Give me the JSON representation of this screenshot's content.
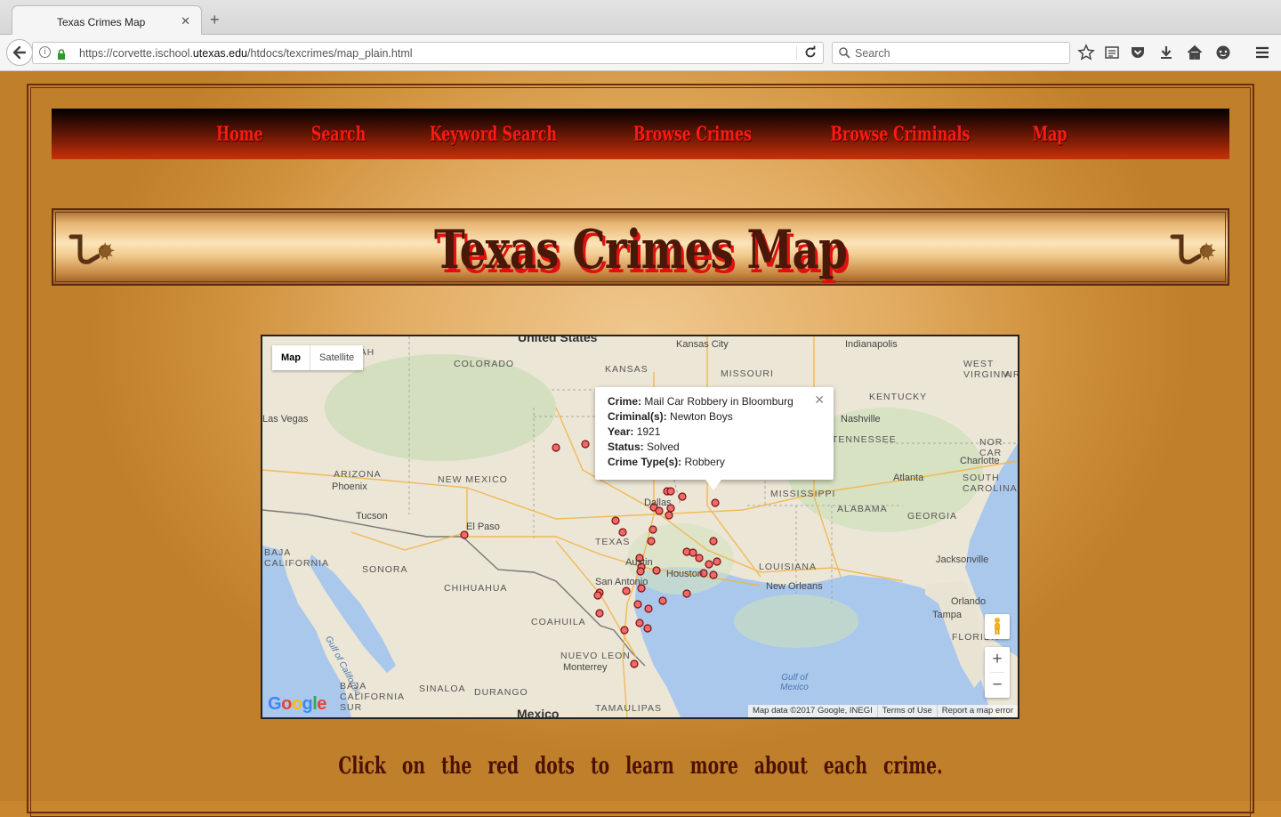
{
  "browser": {
    "tab_title": "Texas Crimes Map",
    "url_prefix": "https://corvette.ischool.",
    "url_domain": "utexas.edu",
    "url_suffix": "/htdocs/texcrimes/map_plain.html",
    "search_placeholder": "Search"
  },
  "nav": {
    "items": [
      "Home",
      "Search",
      "Keyword Search",
      "Browse Crimes",
      "Browse Criminals",
      "Map"
    ]
  },
  "banner": {
    "title": "Texas Crimes Map"
  },
  "map": {
    "type_buttons": [
      "Map",
      "Satellite"
    ],
    "selected_type": "Map",
    "infowindow": {
      "crime_label": "Crime:",
      "crime_value": "Mail Car Robbery in Bloomburg",
      "criminals_label": "Criminal(s):",
      "criminals_value": "Newton Boys",
      "year_label": "Year:",
      "year_value": "1921",
      "status_label": "Status:",
      "status_value": "Solved",
      "type_label": "Crime Type(s):",
      "type_value": "Robbery"
    },
    "zoom_in": "+",
    "zoom_out": "−",
    "attribution": [
      "Map data ©2017 Google, INEGI",
      "Terms of Use",
      "Report a map error"
    ],
    "logo": "Google",
    "labels": {
      "united_states": "United States",
      "kansas_city": "Kansas City",
      "indianapolis": "Indianapolis",
      "colorado": "COLORADO",
      "kansas": "KANSAS",
      "missouri": "MISSOURI",
      "west_virginia": "WEST VIRGINIA",
      "kentucky": "KENTUCKY",
      "las_vegas": "Las Vegas",
      "nashville": "Nashville",
      "tennessee": "TENNESSEE",
      "arizona": "ARIZONA",
      "phoenix": "Phoenix",
      "new_mexico": "NEW MEXICO",
      "charlotte": "Charlotte",
      "atlanta": "Atlanta",
      "mississippi": "MISSISSIPPI",
      "south_carolina": "SOUTH CAROLINA",
      "dallas": "Dallas",
      "tucson": "Tucson",
      "el_paso": "El Paso",
      "alabama": "ALABAMA",
      "georgia": "GEORGIA",
      "texas": "TEXAS",
      "baja_california": "BAJA CALIFORNIA",
      "sonora": "SONORA",
      "austin": "Austin",
      "louisiana": "LOUISIANA",
      "jacksonville": "Jacksonville",
      "chihuahua": "CHIHUAHUA",
      "san_antonio": "San Antonio",
      "houston": "Houston",
      "new_orleans": "New Orleans",
      "orlando": "Orlando",
      "tampa": "Tampa",
      "coahuila": "COAHUILA",
      "gulf_of_california": "Gulf of California",
      "nuevo_leon": "NUEVO LEON",
      "monterrey": "Monterrey",
      "florida": "FLORIDA",
      "gulf_of_mexico": "Gulf of Mexico",
      "baja_california_sur": "BAJA CALIFORNIA SUR",
      "sinaloa": "SINALOA",
      "durango": "DURANGO",
      "tamaulipas": "TAMAULIPAS",
      "mexico": "Mexico",
      "north_carolina": "NOR CAR",
      "virginia": "VIRG",
      "utah": "TAH"
    }
  },
  "caption": "Click on the red dots to learn more about each crime.",
  "colors": {
    "nav_text": "#ff1a10",
    "title_text": "#4a1808",
    "title_shadow": "#e01010",
    "marker": "#f06a6a"
  }
}
